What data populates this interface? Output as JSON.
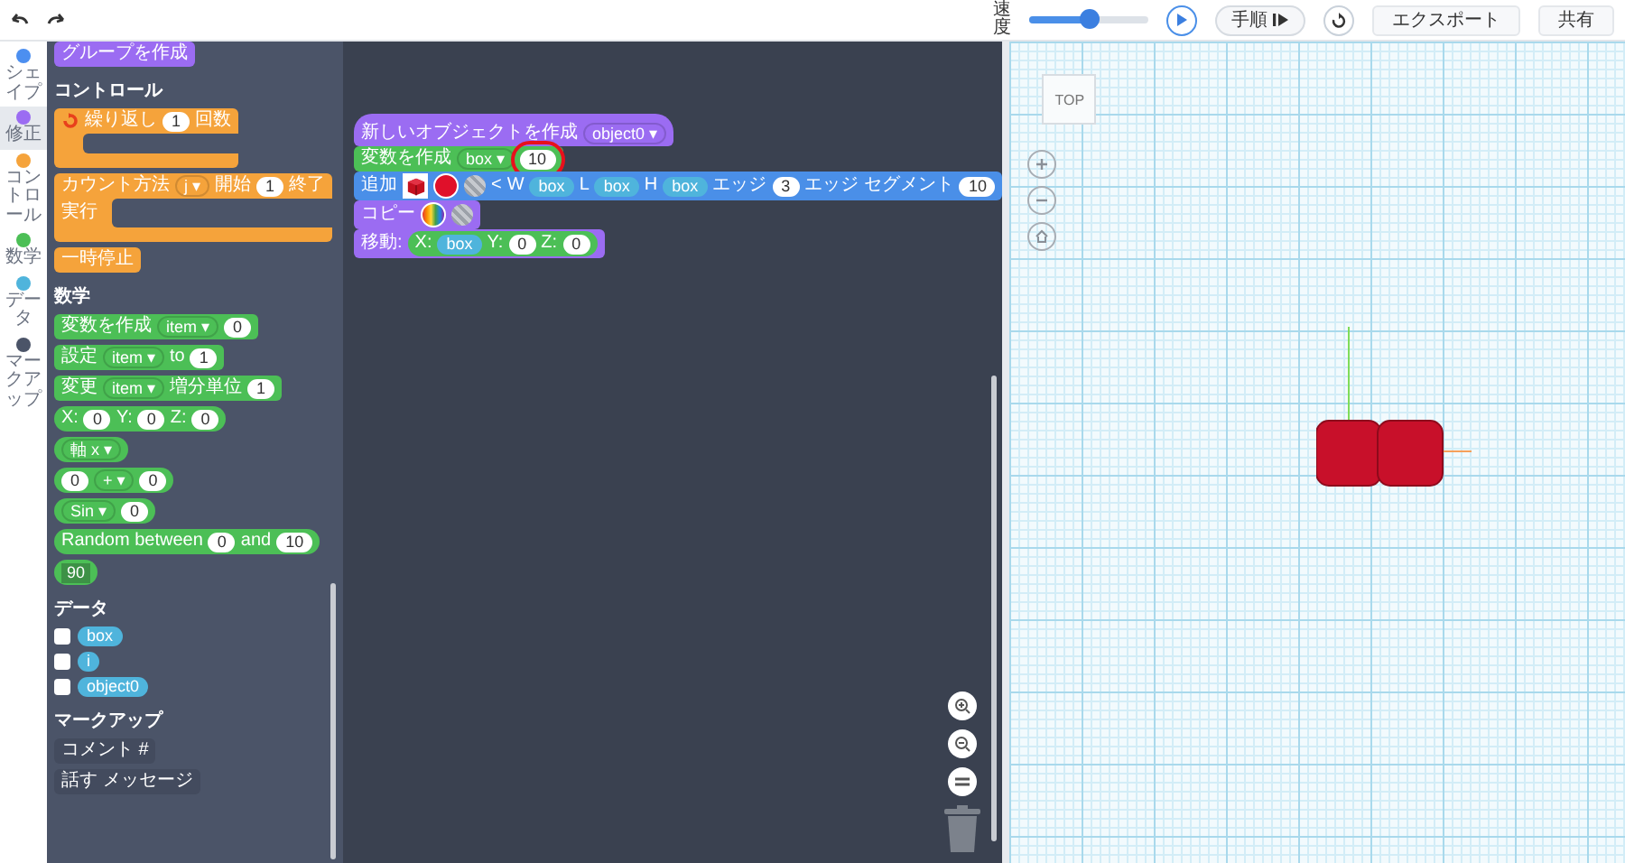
{
  "toolbar": {
    "speed_label": "速度",
    "speed": {
      "level": 0.5
    },
    "step_button": "手順",
    "export_button": "エクスポート",
    "share_button": "共有"
  },
  "categories": [
    {
      "label": "シェイプ",
      "color": "#4c8ff0",
      "selected": false
    },
    {
      "label": "修正",
      "color": "#9b6cf2",
      "selected": true
    },
    {
      "label": "コントロール",
      "color": "#f5a33b",
      "selected": false
    },
    {
      "label": "数学",
      "color": "#4cbf56",
      "selected": false
    },
    {
      "label": "データ",
      "color": "#4fb4dc",
      "selected": false
    },
    {
      "label": "マークアップ",
      "color": "#4b5468",
      "selected": false
    }
  ],
  "flyout": {
    "items": [
      {
        "kind": "block",
        "color": "#9b6cf2",
        "parts": [
          {
            "kind": "text",
            "text": "グループを作成"
          }
        ]
      },
      {
        "kind": "header",
        "text": "コントロール"
      },
      {
        "kind": "c_block",
        "color": "#f5a33b",
        "parts": [
          {
            "kind": "repeat_icon"
          },
          {
            "kind": "text",
            "text": "繰り返し"
          },
          {
            "kind": "num",
            "text": "1"
          },
          {
            "kind": "text",
            "text": "回数"
          }
        ]
      },
      {
        "kind": "c_block",
        "color": "#f5a33b",
        "parts": [
          {
            "kind": "text",
            "text": "カウント方法"
          },
          {
            "kind": "dropdown",
            "text": "j ▾"
          },
          {
            "kind": "text",
            "text": "開始"
          },
          {
            "kind": "num",
            "text": "1"
          },
          {
            "kind": "text",
            "text": "終了"
          }
        ],
        "inner_label": "実行"
      },
      {
        "kind": "block",
        "color": "#f5a33b",
        "parts": [
          {
            "kind": "text",
            "text": "一時停止"
          }
        ]
      },
      {
        "kind": "header",
        "text": "数学"
      },
      {
        "kind": "block",
        "color": "#4cbf56",
        "parts": [
          {
            "kind": "text",
            "text": "変数を作成"
          },
          {
            "kind": "dropdown",
            "text": "item ▾"
          },
          {
            "kind": "num",
            "text": "0"
          }
        ]
      },
      {
        "kind": "block",
        "color": "#4cbf56",
        "parts": [
          {
            "kind": "text",
            "text": "設定"
          },
          {
            "kind": "dropdown",
            "text": "item ▾"
          },
          {
            "kind": "text",
            "text": "to"
          },
          {
            "kind": "num",
            "text": "1"
          }
        ]
      },
      {
        "kind": "block",
        "color": "#4cbf56",
        "parts": [
          {
            "kind": "text",
            "text": "変更"
          },
          {
            "kind": "dropdown",
            "text": "item ▾"
          },
          {
            "kind": "text",
            "text": "増分単位"
          },
          {
            "kind": "num",
            "text": "1"
          }
        ]
      },
      {
        "kind": "reporter",
        "color": "#4cbf56",
        "parts": [
          {
            "kind": "text",
            "text": "X:"
          },
          {
            "kind": "num",
            "text": "0"
          },
          {
            "kind": "text",
            "text": "Y:"
          },
          {
            "kind": "num",
            "text": "0"
          },
          {
            "kind": "text",
            "text": "Z:"
          },
          {
            "kind": "num",
            "text": "0"
          }
        ]
      },
      {
        "kind": "reporter",
        "color": "#4cbf56",
        "parts": [
          {
            "kind": "dropdown",
            "text": "軸 x ▾"
          }
        ]
      },
      {
        "kind": "reporter",
        "color": "#4cbf56",
        "parts": [
          {
            "kind": "num",
            "text": "0"
          },
          {
            "kind": "dropdown",
            "text": "+ ▾"
          },
          {
            "kind": "num",
            "text": "0"
          }
        ]
      },
      {
        "kind": "reporter",
        "color": "#4cbf56",
        "parts": [
          {
            "kind": "dropdown",
            "text": "Sin ▾"
          },
          {
            "kind": "num",
            "text": "0"
          }
        ]
      },
      {
        "kind": "reporter",
        "color": "#4cbf56",
        "parts": [
          {
            "kind": "text",
            "text": "Random between"
          },
          {
            "kind": "num",
            "text": "0"
          },
          {
            "kind": "text",
            "text": "and"
          },
          {
            "kind": "num",
            "text": "10"
          }
        ]
      },
      {
        "kind": "reporter",
        "color": "#4cbf56",
        "parts": [
          {
            "kind": "field",
            "text": "90"
          }
        ]
      },
      {
        "kind": "header",
        "text": "データ"
      },
      {
        "kind": "checkbox",
        "label": "box",
        "checked": false
      },
      {
        "kind": "checkbox",
        "label": "i",
        "checked": false
      },
      {
        "kind": "checkbox",
        "label": "object0",
        "checked": false
      },
      {
        "kind": "header",
        "text": "マークアップ"
      },
      {
        "kind": "block",
        "color": "#434b5e",
        "parts": [
          {
            "kind": "text",
            "text": "コメント #"
          }
        ]
      },
      {
        "kind": "block",
        "color": "#434b5e",
        "parts": [
          {
            "kind": "text",
            "text": "話す"
          },
          {
            "kind": "text",
            "text": "メッセージ"
          }
        ]
      }
    ]
  },
  "workspace": {
    "script": [
      {
        "kind": "hat",
        "color": "#9b6cf2",
        "parts": [
          {
            "kind": "text",
            "text": "新しいオブジェクトを作成"
          },
          {
            "kind": "dropdown",
            "text": "object0 ▾"
          }
        ]
      },
      {
        "kind": "block",
        "color": "#4cbf56",
        "parts": [
          {
            "kind": "text",
            "text": "変数を作成"
          },
          {
            "kind": "dropdown",
            "text": "box ▾"
          },
          {
            "kind": "num",
            "text": "10",
            "highlighted": true
          }
        ]
      },
      {
        "kind": "block",
        "color": "#4a8fe8",
        "parts": [
          {
            "kind": "text",
            "text": "追加"
          },
          {
            "kind": "cube"
          },
          {
            "kind": "swatch",
            "color": "#e0102a"
          },
          {
            "kind": "striped"
          },
          {
            "kind": "text",
            "text": "<"
          },
          {
            "kind": "text",
            "text": "W"
          },
          {
            "kind": "var",
            "text": "box"
          },
          {
            "kind": "text",
            "text": "L"
          },
          {
            "kind": "var",
            "text": "box"
          },
          {
            "kind": "text",
            "text": "H"
          },
          {
            "kind": "var",
            "text": "box"
          },
          {
            "kind": "text",
            "text": "エッジ"
          },
          {
            "kind": "num",
            "text": "3",
            "highlighted": false
          },
          {
            "kind": "text",
            "text": "エッジ セグメント"
          },
          {
            "kind": "num",
            "text": "10",
            "highlighted": false
          }
        ]
      },
      {
        "kind": "block",
        "color": "#9b6cf2",
        "parts": [
          {
            "kind": "text",
            "text": "コピー"
          },
          {
            "kind": "rainbow"
          },
          {
            "kind": "striped"
          }
        ]
      },
      {
        "kind": "block",
        "color": "#9b6cf2",
        "parts": [
          {
            "kind": "text",
            "text": "移動:"
          },
          {
            "kind": "inner",
            "color": "#4cbf56",
            "parts": [
              {
                "kind": "text",
                "text": "X:"
              },
              {
                "kind": "var",
                "text": "box"
              },
              {
                "kind": "text",
                "text": "Y:"
              },
              {
                "kind": "num",
                "text": "0",
                "highlighted": false
              },
              {
                "kind": "text",
                "text": "Z:"
              },
              {
                "kind": "num",
                "text": "0",
                "highlighted": false
              }
            ]
          }
        ]
      }
    ]
  },
  "viewport": {
    "view_cube_label": "TOP"
  }
}
